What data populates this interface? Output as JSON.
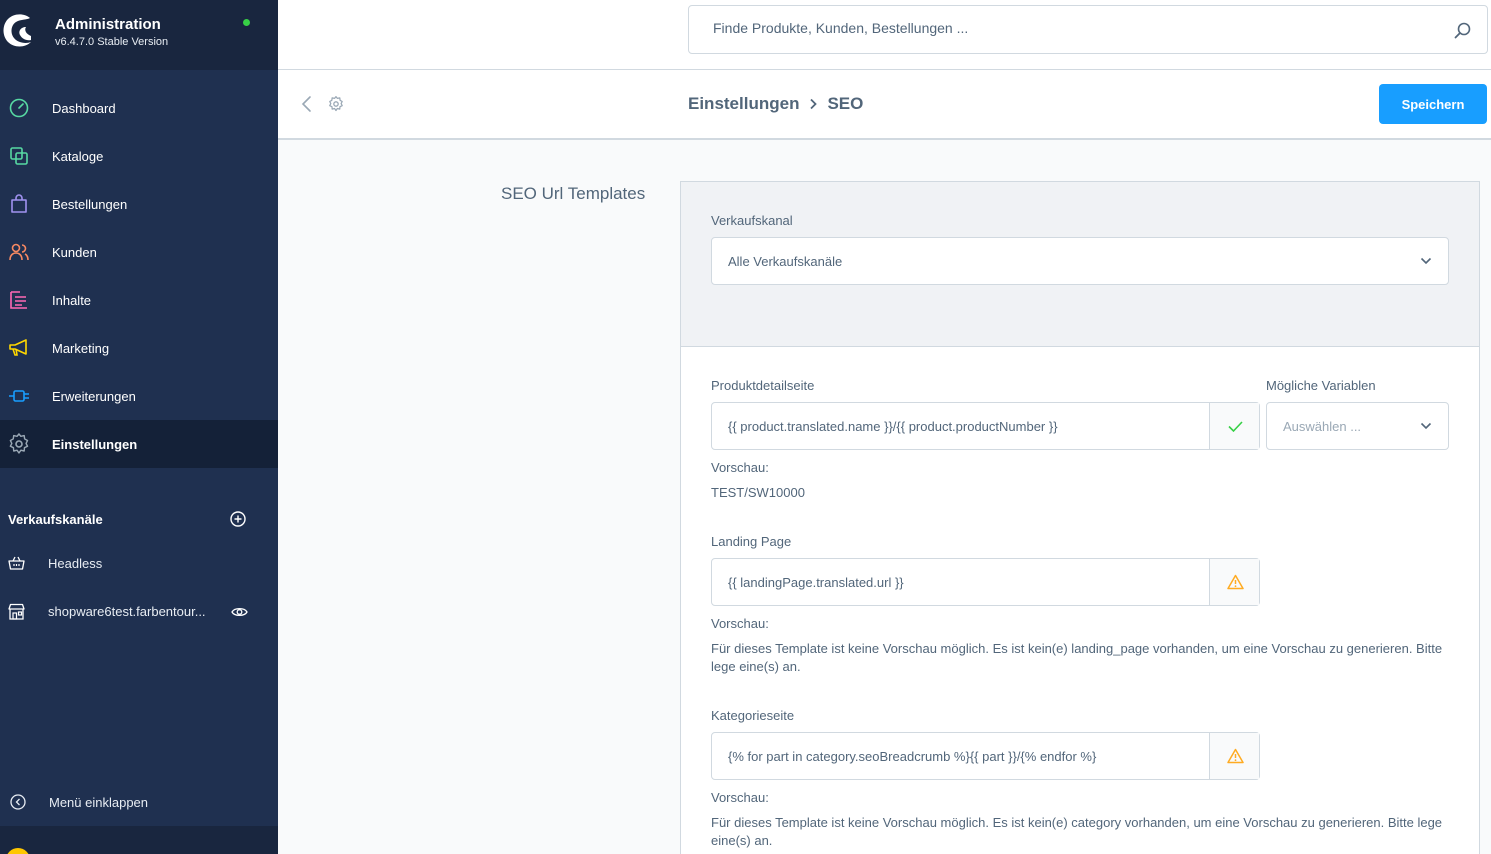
{
  "app": {
    "title": "Administration",
    "version": "v6.4.7.0 Stable Version",
    "status_color": "#37d046"
  },
  "nav": {
    "items": [
      {
        "label": "Dashboard",
        "icon": "dashboard-icon",
        "color": "#57d9a3"
      },
      {
        "label": "Kataloge",
        "icon": "catalog-icon",
        "color": "#57d9a3"
      },
      {
        "label": "Bestellungen",
        "icon": "orders-icon",
        "color": "#a092f0"
      },
      {
        "label": "Kunden",
        "icon": "customers-icon",
        "color": "#f88962"
      },
      {
        "label": "Inhalte",
        "icon": "content-icon",
        "color": "#ff68b4"
      },
      {
        "label": "Marketing",
        "icon": "marketing-icon",
        "color": "#ffd700"
      },
      {
        "label": "Erweiterungen",
        "icon": "extensions-icon",
        "color": "#189eff"
      },
      {
        "label": "Einstellungen",
        "icon": "settings-icon",
        "color": "#9aa8b5"
      }
    ]
  },
  "sales_channels": {
    "title": "Verkaufskanäle",
    "items": [
      {
        "label": "Headless"
      },
      {
        "label": "shopware6test.farbentour..."
      }
    ]
  },
  "collapse_menu": "Menü einklappen",
  "search": {
    "placeholder": "Finde Produkte, Kunden, Bestellungen ..."
  },
  "smartbar": {
    "crumb_parent": "Einstellungen",
    "crumb_current": "SEO",
    "save_label": "Speichern",
    "accent": "#189eff"
  },
  "main": {
    "section_title": "SEO Url Templates",
    "sales_channel_label": "Verkaufskanal",
    "sales_channel_value": "Alle Verkaufskanäle",
    "templates": [
      {
        "label": "Produktdetailseite",
        "value": "{{ product.translated.name }}/{{ product.productNumber }}",
        "status": "valid",
        "preview_label": "Vorschau:",
        "preview": "TEST/SW10000"
      },
      {
        "label": "Landing Page",
        "value": "{{ landingPage.translated.url }}",
        "status": "warning",
        "preview_label": "Vorschau:",
        "preview": "Für dieses Template ist keine Vorschau möglich. Es ist kein(e) landing_page vorhanden, um eine Vorschau zu generieren. Bitte lege eine(s) an."
      },
      {
        "label": "Kategorieseite",
        "value": "{% for part in category.seoBreadcrumb %}{{ part }}/{% endfor %}",
        "status": "warning",
        "preview_label": "Vorschau:",
        "preview": "Für dieses Template ist keine Vorschau möglich. Es ist kein(e) category vorhanden, um eine Vorschau zu generieren. Bitte lege eine(s) an."
      }
    ],
    "variables_label": "Mögliche Variablen",
    "variables_placeholder": "Auswählen ..."
  }
}
